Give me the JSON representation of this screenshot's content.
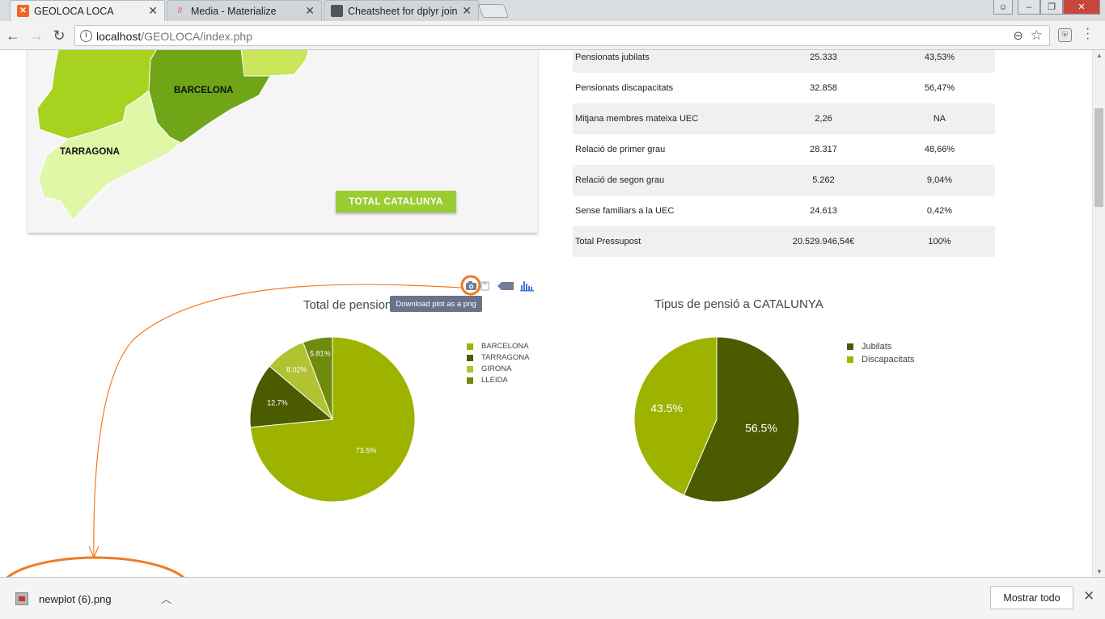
{
  "browser": {
    "tabs": [
      {
        "title": "GEOLOCA LOCA",
        "active": true
      },
      {
        "title": "Media - Materialize",
        "active": false
      },
      {
        "title": "Cheatsheet for dplyr join",
        "active": false
      }
    ],
    "url_host": "localhost",
    "url_path": "/GEOLOCA/index.php"
  },
  "map": {
    "regions": [
      "BARCELONA",
      "TARRAGONA"
    ],
    "colors": {
      "barcelona": "#6fa516",
      "tarragona": "#e0f7a8",
      "lleida": "#a7d21f",
      "girona": "#cbe55a"
    },
    "button_label": "TOTAL CATALUNYA"
  },
  "stats_table": {
    "rows": [
      [
        "Pensionats jubilats",
        "25.333",
        "43,53%"
      ],
      [
        "Pensionats discapacitats",
        "32.858",
        "56,47%"
      ],
      [
        "Mitjana membres mateixa UEC",
        "2,26",
        "NA"
      ],
      [
        "Relació de primer grau",
        "28.317",
        "48,66%"
      ],
      [
        "Relació de segon grau",
        "5.262",
        "9,04%"
      ],
      [
        "Sense familiars a la UEC",
        "24.613",
        "0,42%"
      ],
      [
        "Total Pressupost",
        "20.529.946,54€",
        "100%"
      ]
    ]
  },
  "modebar": {
    "tooltip": "Download plot as a png",
    "icons": [
      "camera-icon",
      "save-icon",
      "tag-icon",
      "plotly-logo-icon"
    ]
  },
  "chart_data": [
    {
      "type": "pie",
      "title": "Total de pensionat",
      "categories": [
        "BARCELONA",
        "TARRAGONA",
        "GIRONA",
        "LLEIDA"
      ],
      "values": [
        73.5,
        12.7,
        8.02,
        5.81
      ],
      "labels": [
        "73.5%",
        "12.7%",
        "8.02%",
        "5.81%"
      ],
      "colors": [
        "#9eb200",
        "#4b5b00",
        "#b1c232",
        "#6f8a0c"
      ],
      "legend": "right"
    },
    {
      "type": "pie",
      "title": "Tipus de pensió a CATALUNYA",
      "categories": [
        "Jubilats",
        "Discapacitats"
      ],
      "values": [
        56.5,
        43.5
      ],
      "labels": [
        "56.5%",
        "43.5%"
      ],
      "colors": [
        "#4b5b00",
        "#9eb200"
      ],
      "legend": "right"
    }
  ],
  "download_bar": {
    "file_name": "newplot (6).png",
    "show_all": "Mostrar todo"
  }
}
